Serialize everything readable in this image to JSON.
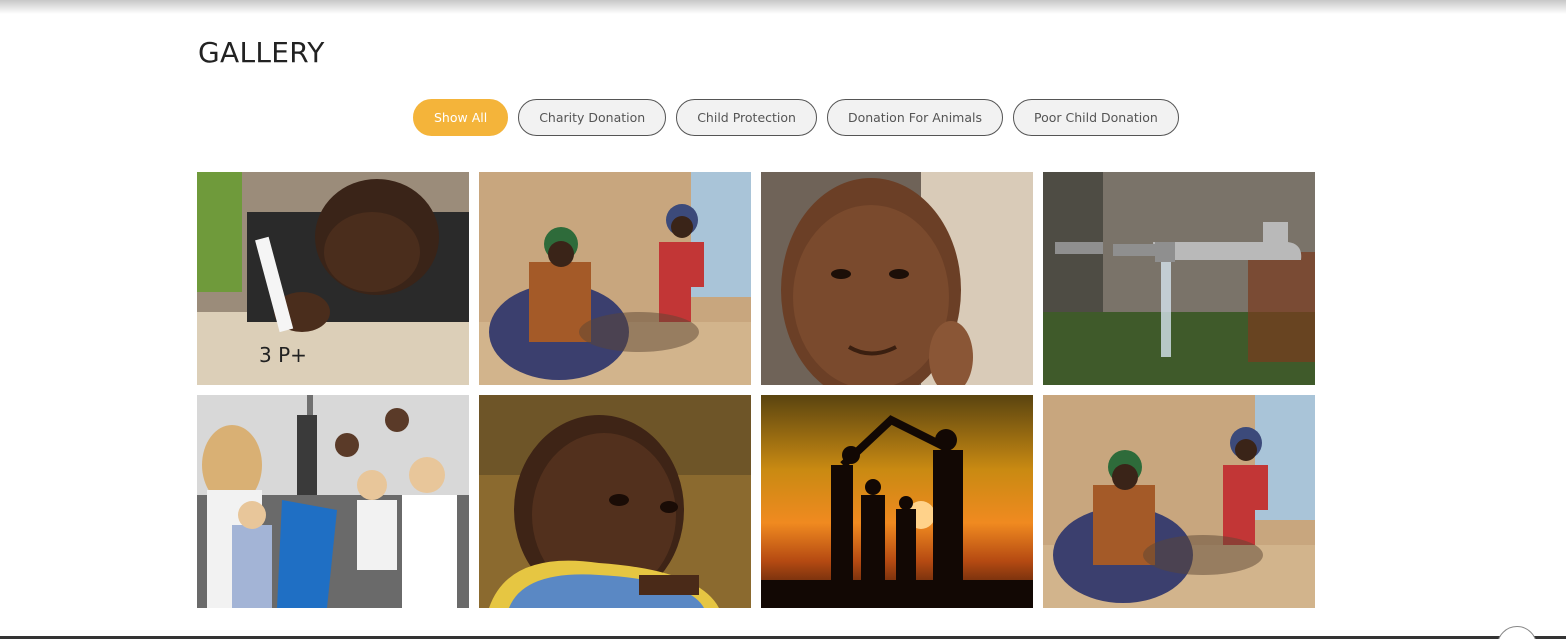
{
  "gallery": {
    "title": "GALLERY",
    "filters": [
      {
        "label": "Show All",
        "active": true
      },
      {
        "label": "Charity Donation",
        "active": false
      },
      {
        "label": "Child Protection",
        "active": false
      },
      {
        "label": "Donation For Animals",
        "active": false
      },
      {
        "label": "Poor Child Donation",
        "active": false
      }
    ],
    "accent_color": "#f4b43a",
    "items": [
      {
        "subject": "boy writing with marker"
      },
      {
        "subject": "woman and child sitting by wall"
      },
      {
        "subject": "smiling boy leaning on wall"
      },
      {
        "subject": "dripping water tap"
      },
      {
        "subject": "volunteers handing out gifts"
      },
      {
        "subject": "young child portrait"
      },
      {
        "subject": "family silhouette at sunset"
      },
      {
        "subject": "woman and child sitting by wall"
      }
    ]
  }
}
